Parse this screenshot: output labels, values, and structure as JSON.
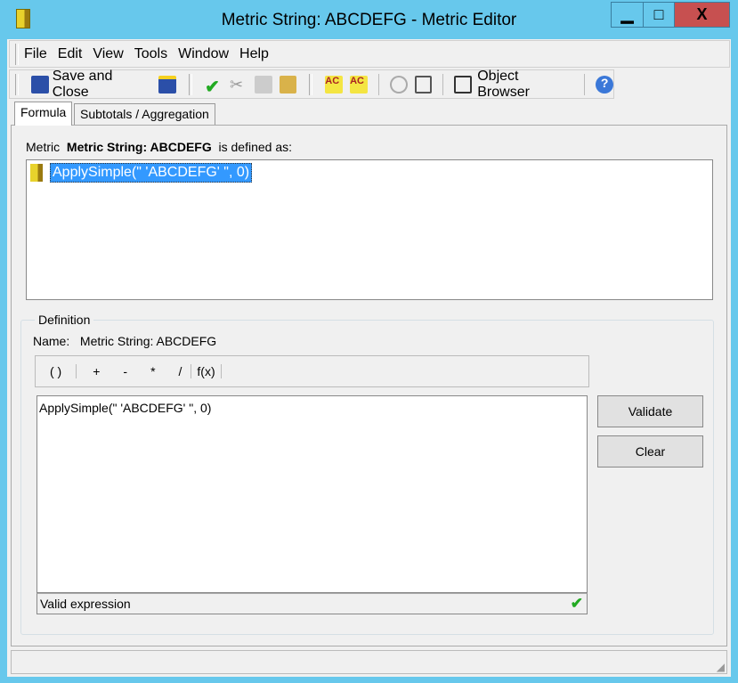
{
  "window": {
    "title": "Metric String: ABCDEFG - Metric Editor",
    "minimize": "▁",
    "maximize": "□",
    "close": "X"
  },
  "menu": [
    "File",
    "Edit",
    "View",
    "Tools",
    "Window",
    "Help"
  ],
  "toolbar": {
    "save_close": "Save and Close",
    "object_browser": "Object Browser"
  },
  "tabs": [
    "Formula",
    "Subtotals / Aggregation"
  ],
  "formula": {
    "prefix": "Metric",
    "metric_name": "Metric String: ABCDEFG",
    "suffix": "is defined as:",
    "tree_item": "ApplySimple(\" 'ABCDEFG' \", 0)"
  },
  "definition": {
    "legend": "Definition",
    "name_label": "Name:",
    "name_value": "Metric String: ABCDEFG",
    "ops": [
      "( )",
      "+",
      "-",
      "*",
      "/",
      "f(x)"
    ],
    "expression": "ApplySimple(\" 'ABCDEFG' \", 0)",
    "status": "Valid expression",
    "validate": "Validate",
    "clear": "Clear"
  },
  "colors": {
    "accent": "#3399ff",
    "frame": "#67c8ec",
    "close": "#c75050"
  }
}
